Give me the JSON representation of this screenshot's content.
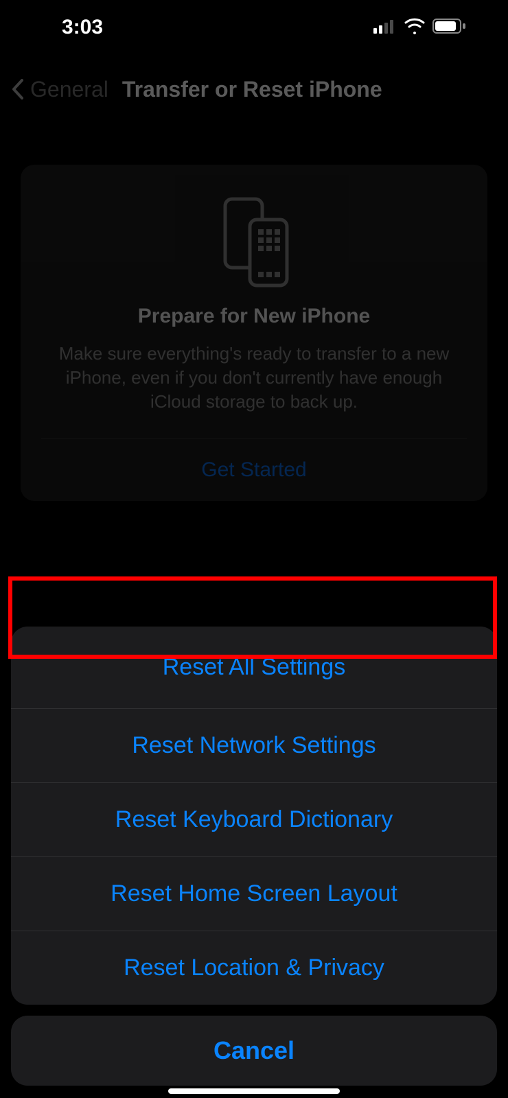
{
  "status": {
    "time": "3:03"
  },
  "nav": {
    "back_label": "General",
    "title": "Transfer or Reset iPhone"
  },
  "card": {
    "title": "Prepare for New iPhone",
    "body": "Make sure everything's ready to transfer to a new iPhone, even if you don't currently have enough iCloud storage to back up.",
    "action": "Get Started"
  },
  "sheet": {
    "items": [
      "Reset All Settings",
      "Reset Network Settings",
      "Reset Keyboard Dictionary",
      "Reset Home Screen Layout",
      "Reset Location & Privacy"
    ],
    "cancel": "Cancel"
  },
  "annotation": {
    "highlighted_index": 0
  }
}
